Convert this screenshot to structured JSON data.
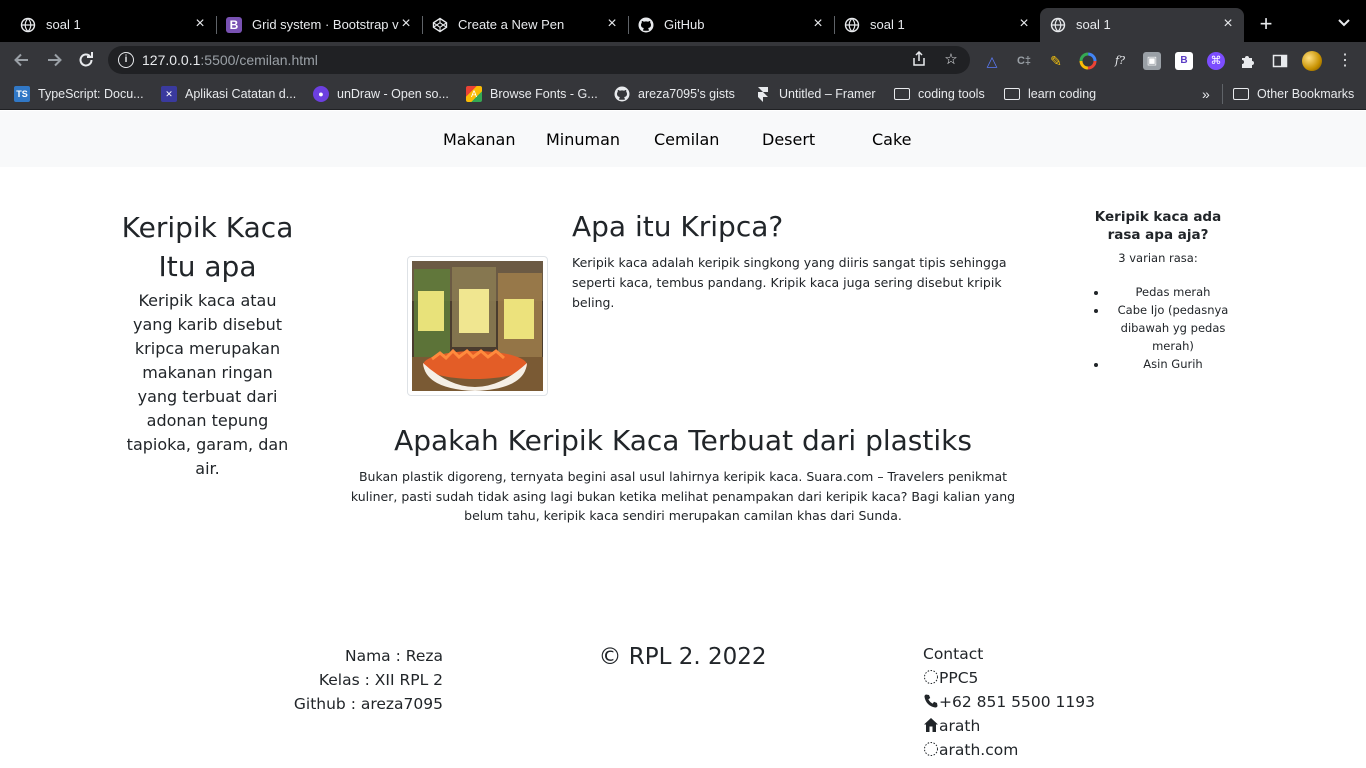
{
  "browser": {
    "tabs": [
      {
        "title": "soal 1",
        "icon": "globe-icon"
      },
      {
        "title": "Grid system · Bootstrap v",
        "icon": "bootstrap-icon"
      },
      {
        "title": "Create a New Pen",
        "icon": "codepen-icon"
      },
      {
        "title": "GitHub",
        "icon": "github-icon"
      },
      {
        "title": "soal 1",
        "icon": "globe-icon"
      },
      {
        "title": "soal 1",
        "icon": "globe-icon",
        "active": true
      }
    ],
    "url_host": "127.0.0.1",
    "url_rest": ":5500/cemilan.html",
    "bookmarks": [
      {
        "label": "TypeScript: Docu...",
        "icon": "ts-icon"
      },
      {
        "label": "Aplikasi Catatan d...",
        "icon": "notes-icon"
      },
      {
        "label": "unDraw - Open so...",
        "icon": "undraw-icon"
      },
      {
        "label": "Browse Fonts - G...",
        "icon": "google-fonts-icon"
      },
      {
        "label": "areza7095's gists",
        "icon": "github-icon"
      },
      {
        "label": "Untitled – Framer",
        "icon": "framer-icon"
      },
      {
        "label": "coding tools",
        "icon": "folder-icon"
      },
      {
        "label": "learn coding",
        "icon": "folder-icon"
      }
    ],
    "overflow": "»",
    "other_bookmarks": "Other Bookmarks"
  },
  "nav": {
    "items": [
      "Makanan",
      "Minuman",
      "Cemilan",
      "Desert",
      "Cake"
    ]
  },
  "left": {
    "title": "Keripik Kaca Itu apa",
    "text": "Keripik kaca atau yang karib disebut kripca merupakan makanan ringan yang terbuat dari adonan tepung tapioka, garam, dan air."
  },
  "center": {
    "title": "Apa itu Kripca?",
    "text": "Keripik kaca adalah keripik singkong yang diiris sangat tipis sehingga seperti kaca, tembus pandang. Kripik kaca juga sering disebut kripik beling.",
    "title2": "Apakah Keripik Kaca Terbuat dari plastiks",
    "text2": "Bukan plastik digoreng, ternyata begini asal usul lahirnya keripik kaca. Suara.com – Travelers penikmat kuliner, pasti sudah tidak asing lagi bukan ketika melihat penampakan dari keripik kaca? Bagi kalian yang belum tahu, keripik kaca sendiri merupakan camilan khas dari Sunda."
  },
  "right": {
    "title": "Keripik kaca ada rasa apa aja?",
    "subtitle": "3 varian rasa:",
    "items": [
      "Pedas merah",
      "Cabe Ijo (pedasnya dibawah yg pedas merah)",
      "Asin Gurih"
    ]
  },
  "footer": {
    "nama": "Nama : Reza",
    "kelas": "Kelas : XII RPL 2",
    "github": "Github : areza7095",
    "copyright": "© RPL 2. 2022",
    "contact_title": "Contact",
    "contact": [
      {
        "icon": "missing-glyph-icon",
        "text": "PPC5"
      },
      {
        "icon": "phone-icon",
        "text": "+62 851 5500 1193"
      },
      {
        "icon": "home-icon",
        "text": "arath"
      },
      {
        "icon": "missing-glyph-icon",
        "text": "arath.com"
      }
    ]
  }
}
